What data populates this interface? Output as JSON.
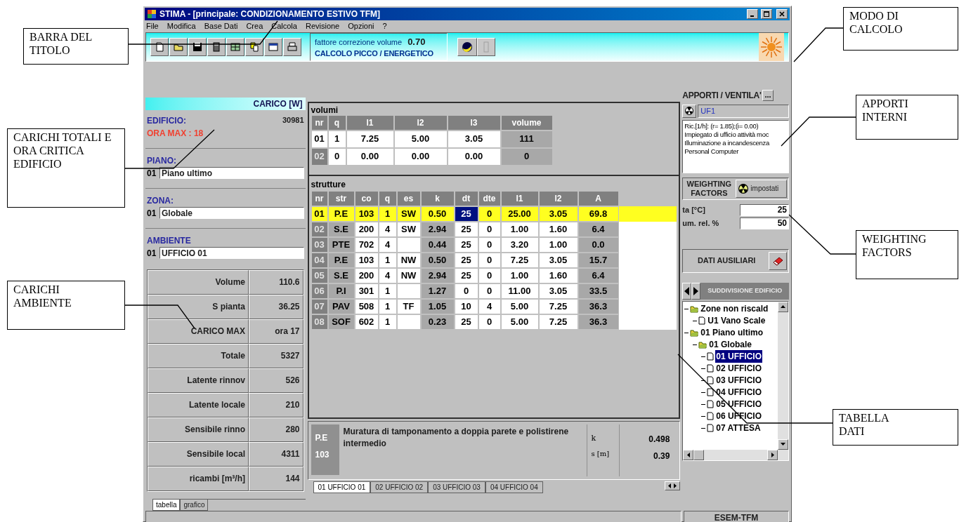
{
  "window": {
    "title": "STIMA - [principale: CONDIZIONAMENTO ESTIVO TFM]"
  },
  "menu": [
    "File",
    "Modifica",
    "Base Dati",
    "Crea",
    "Calcola",
    "Revisione",
    "Opzioni",
    "?"
  ],
  "toolbar": {
    "factor_label": "fattore correzione volume",
    "factor_value": "0.70",
    "mode": "CALCOLO PICCO / ENERGETICO"
  },
  "loads": {
    "title": "CARICO [W]",
    "building_label": "EDIFICIO:",
    "building_value": "30981",
    "peak_hour": "ORA MAX : 18",
    "selectors": [
      {
        "label": "PIANO:",
        "code": "01",
        "value": "Piano ultimo"
      },
      {
        "label": "ZONA:",
        "code": "01",
        "value": "Globale"
      },
      {
        "label": "AMBIENTE",
        "code": "01",
        "value": "UFFICIO 01"
      }
    ],
    "rows": [
      {
        "label": "Volume",
        "value": "110.6"
      },
      {
        "label": "S pianta",
        "value": "36.25"
      },
      {
        "label": "CARICO MAX",
        "value": "ora  17"
      },
      {
        "label": "Totale",
        "value": "5327"
      },
      {
        "label": "Latente rinnov",
        "value": "526"
      },
      {
        "label": "Latente locale",
        "value": "210"
      },
      {
        "label": "Sensibile rinno",
        "value": "280"
      },
      {
        "label": "Sensibile local",
        "value": "4311"
      },
      {
        "label": "ricambi [m³/h]",
        "value": "144"
      }
    ],
    "tabs": [
      {
        "label": "tabella",
        "selected": true
      },
      {
        "label": "grafico",
        "selected": false
      }
    ]
  },
  "volumi": {
    "title": "volumi",
    "columns": [
      "nr",
      "q",
      "l1",
      "l2",
      "l3",
      "volume"
    ],
    "rows": [
      [
        "01",
        "1",
        "7.25",
        "5.00",
        "3.05",
        "111"
      ],
      [
        "02",
        "0",
        "0.00",
        "0.00",
        "0.00",
        "0"
      ]
    ]
  },
  "strutture": {
    "title": "strutture",
    "columns": [
      "nr",
      "str",
      "co",
      "q",
      "es",
      "k",
      "dt",
      "dte",
      "l1",
      "l2",
      "A"
    ],
    "rows": [
      {
        "selected": true,
        "cells": [
          "01",
          "P.E",
          "103",
          "1",
          "SW",
          "0.50",
          {
            "value": "25",
            "focused": true
          },
          "0",
          "25.00",
          "3.05",
          "69.8"
        ]
      },
      {
        "selected": false,
        "cells": [
          "02",
          "S.E",
          "200",
          "4",
          "SW",
          "2.94",
          "25",
          "0",
          "1.00",
          "1.60",
          "6.4"
        ]
      },
      {
        "selected": false,
        "cells": [
          "03",
          "PTE",
          "702",
          "4",
          null,
          "0.44",
          "25",
          "0",
          "3.20",
          "1.00",
          "0.0"
        ]
      },
      {
        "selected": false,
        "cells": [
          "04",
          "P.E",
          "103",
          "1",
          "NW",
          "0.50",
          "25",
          "0",
          "7.25",
          "3.05",
          "15.7"
        ]
      },
      {
        "selected": false,
        "cells": [
          "05",
          "S.E",
          "200",
          "4",
          "NW",
          "2.94",
          "25",
          "0",
          "1.00",
          "1.60",
          "6.4"
        ]
      },
      {
        "selected": false,
        "cells": [
          "06",
          "P.I",
          "301",
          "1",
          null,
          "1.27",
          "0",
          "0",
          "11.00",
          "3.05",
          "33.5"
        ]
      },
      {
        "selected": false,
        "cells": [
          "07",
          "PAV",
          "508",
          "1",
          "TF",
          "1.05",
          "10",
          "4",
          "5.00",
          "7.25",
          "36.3"
        ]
      },
      {
        "selected": false,
        "cells": [
          "08",
          "SOF",
          "602",
          "1",
          null,
          "0.23",
          "25",
          "0",
          "5.00",
          "7.25",
          "36.3"
        ]
      }
    ]
  },
  "detail": {
    "type": "P.E",
    "code": "103",
    "description": "Muratura di tamponamento a doppia parete e polistirene intermedio",
    "k_label": "k",
    "k_value": "0.498",
    "s_label": "s [m]",
    "s_value": "0.39"
  },
  "room_tabs": [
    {
      "label": "01 UFFICIO 01",
      "selected": true
    },
    {
      "label": "02 UFFICIO 02",
      "selected": false
    },
    {
      "label": "03 UFFICIO 03",
      "selected": false
    },
    {
      "label": "04 UFFICIO 04",
      "selected": false
    }
  ],
  "apporti": {
    "title": "APPORTI / VENTILA'",
    "more": "...",
    "code": "UF1",
    "lines": [
      "Ric.[1/h]: (r= 1.85);(i= 0.00)",
      "Impiegato di ufficio attività moc",
      "Illuminazione a incandescenza",
      "Personal Computer"
    ]
  },
  "weighting": {
    "label": "WEIGHTING FACTORS",
    "button": "impostati"
  },
  "conditions": [
    {
      "label": "ta [°C]",
      "value": "25"
    },
    {
      "label": "um. rel. %",
      "value": "50"
    }
  ],
  "aux_button": "DATI AUSILIARI",
  "tree": {
    "title": "SUDDIVISIONE EDIFICIO",
    "items": [
      {
        "label": "Zone non riscald",
        "kind": "folder",
        "selected": false,
        "children": [
          {
            "label": "U1 Vano Scale",
            "kind": "file",
            "selected": false
          }
        ]
      },
      {
        "label": "01 Piano ultimo",
        "kind": "folder",
        "selected": false,
        "children": [
          {
            "label": "01 Globale",
            "kind": "folder",
            "selected": false,
            "children": [
              {
                "label": "01 UFFICIO",
                "kind": "file",
                "selected": true
              },
              {
                "label": "02 UFFICIO",
                "kind": "file",
                "selected": false
              },
              {
                "label": "03 UFFICIO",
                "kind": "file",
                "selected": false
              },
              {
                "label": "04 UFFICIO",
                "kind": "file",
                "selected": false
              },
              {
                "label": "05 UFFICIO",
                "kind": "file",
                "selected": false
              },
              {
                "label": "06 UFFICIO",
                "kind": "file",
                "selected": false
              },
              {
                "label": "07 ATTESA",
                "kind": "file",
                "selected": false
              }
            ]
          }
        ]
      }
    ]
  },
  "status_bar": {
    "right": "ESEM-TFM"
  },
  "callouts": [
    {
      "text": "BARRA DEL TITOLO"
    },
    {
      "text": "CARICHI TOTALI E ORA CRITICA EDIFICIO"
    },
    {
      "text": "CARICHI AMBIENTE"
    },
    {
      "text": "MODO DI CALCOLO"
    },
    {
      "text": "APPORTI INTERNI"
    },
    {
      "text": "WEIGHTING FACTORS"
    },
    {
      "text": "TABELLA DATI"
    }
  ]
}
